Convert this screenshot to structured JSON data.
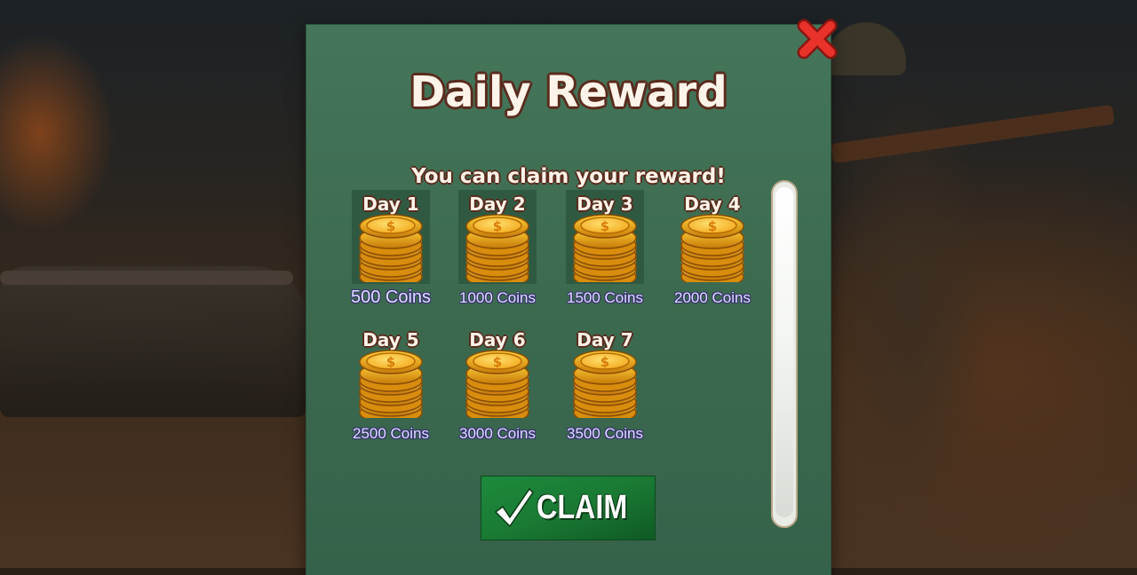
{
  "popup": {
    "title": "Daily Reward",
    "subtitle": "You can claim your reward!",
    "close_icon": "close-x-icon",
    "claim_label": "CLAIM",
    "claim_icon": "checkmark-icon"
  },
  "rewards": [
    {
      "day": "Day 1",
      "amount": "500 Coins"
    },
    {
      "day": "Day 2",
      "amount": "1000 Coins"
    },
    {
      "day": "Day 3",
      "amount": "1500 Coins"
    },
    {
      "day": "Day 4",
      "amount": "2000 Coins"
    },
    {
      "day": "Day 5",
      "amount": "2500 Coins"
    },
    {
      "day": "Day 6",
      "amount": "3000 Coins"
    },
    {
      "day": "Day 7",
      "amount": "3500 Coins"
    }
  ],
  "colors": {
    "panel": "#3f6e53",
    "title_outline": "#5a2b1d",
    "claim_button": "#1a7a34",
    "close_x": "#e8322a",
    "amount_text": "#dce0ff"
  }
}
